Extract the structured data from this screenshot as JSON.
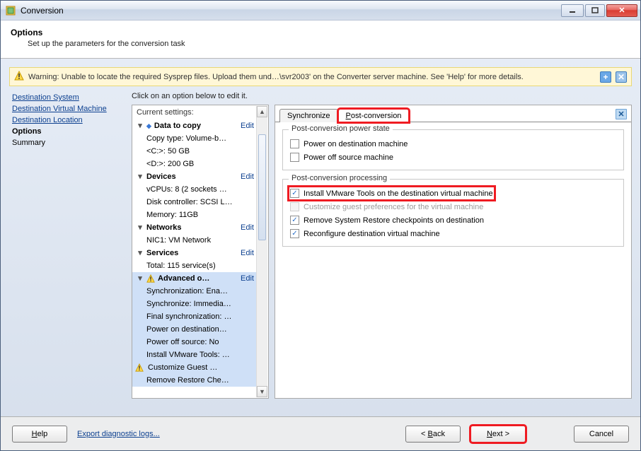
{
  "window": {
    "title": "Conversion"
  },
  "header": {
    "title": "Options",
    "subtitle": "Set up the parameters for the conversion task"
  },
  "warning": {
    "text": "Warning: Unable to locate the required Sysprep files. Upload them und…\\svr2003' on the Converter server machine. See 'Help' for more details."
  },
  "nav": {
    "items": [
      {
        "label": "Destination System",
        "state": "link"
      },
      {
        "label": "Destination Virtual Machine",
        "state": "link"
      },
      {
        "label": "Destination Location",
        "state": "link"
      },
      {
        "label": "Options",
        "state": "current"
      },
      {
        "label": "Summary",
        "state": "plain"
      }
    ]
  },
  "hint": "Click on an option below to edit it.",
  "settings": {
    "title": "Current settings:",
    "editLabel": "Edit",
    "groups": [
      {
        "title": "Data to copy",
        "items": [
          "Copy type: Volume-b…",
          "<C:>: 50 GB",
          "<D:>: 200 GB"
        ]
      },
      {
        "title": "Devices",
        "items": [
          "vCPUs: 8 (2 sockets …",
          "Disk controller: SCSI L…",
          "Memory: 11GB"
        ]
      },
      {
        "title": "Networks",
        "items": [
          "NIC1: VM Network"
        ]
      },
      {
        "title": "Services",
        "items": [
          "Total: 115 service(s)"
        ]
      },
      {
        "title": "Advanced o…",
        "warn": true,
        "selected": true,
        "items": [
          "Synchronization: Ena…",
          "Synchronize: Immedia…",
          "Final synchronization: …",
          "Power on destination…",
          "Power off source: No",
          "Install VMware Tools: …",
          {
            "text": "Customize Guest …",
            "warn": true
          },
          "Remove Restore Che…"
        ]
      }
    ]
  },
  "tabs": {
    "items": [
      {
        "label": "Synchronize",
        "active": false
      },
      {
        "label": "Post-conversion",
        "underlineIndex": 0,
        "active": true
      }
    ]
  },
  "post": {
    "powerState": {
      "legend": "Post-conversion power state",
      "opts": [
        {
          "label": "Power on destination machine",
          "checked": false
        },
        {
          "label": "Power off source machine",
          "checked": false
        }
      ]
    },
    "processing": {
      "legend": "Post-conversion processing",
      "opts": [
        {
          "label": "Install VMware Tools on the destination virtual machine",
          "underlineIndex": 0,
          "checked": true,
          "highlight": true
        },
        {
          "label": "Customize guest preferences for the virtual machine",
          "underlineIndex": 0,
          "checked": false,
          "disabled": true
        },
        {
          "label": "Remove System Restore checkpoints on destination",
          "underlineIndex": 0,
          "checked": true
        },
        {
          "label": "Reconfigure destination virtual machine",
          "checked": true
        }
      ]
    }
  },
  "footer": {
    "help": "Help",
    "export": "Export diagnostic logs...",
    "back": "< Back",
    "next": "Next >",
    "cancel": "Cancel"
  }
}
